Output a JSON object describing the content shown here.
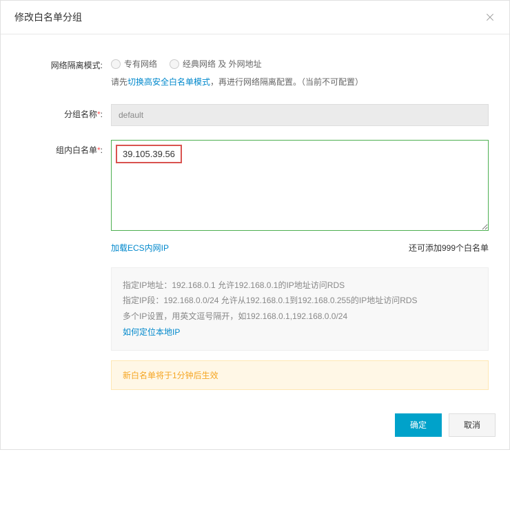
{
  "modal": {
    "title": "修改白名单分组"
  },
  "form": {
    "network_mode": {
      "label": "网络隔离模式:",
      "option_vpc": "专有网络",
      "option_classic": "经典网络 及 外网地址",
      "hint_prefix": "请先",
      "hint_link": "切换高安全白名单模式",
      "hint_suffix": "，再进行网络隔离配置。（当前不可配置）"
    },
    "group_name": {
      "label": "分组名称",
      "value": "default"
    },
    "whitelist": {
      "label": "组内白名单",
      "value": "39.105.39.56",
      "load_ecs_link": "加载ECS内网IP",
      "remaining_text": "还可添加999个白名单"
    },
    "info": {
      "line1": "指定IP地址：192.168.0.1 允许192.168.0.1的IP地址访问RDS",
      "line2": "指定IP段：192.168.0.0/24 允许从192.168.0.1到192.168.0.255的IP地址访问RDS",
      "line3": "多个IP设置，用英文逗号隔开，如192.168.0.1,192.168.0.0/24",
      "locate_ip_link": "如何定位本地IP"
    },
    "warning": "新白名单将于1分钟后生效"
  },
  "footer": {
    "confirm": "确定",
    "cancel": "取消"
  }
}
